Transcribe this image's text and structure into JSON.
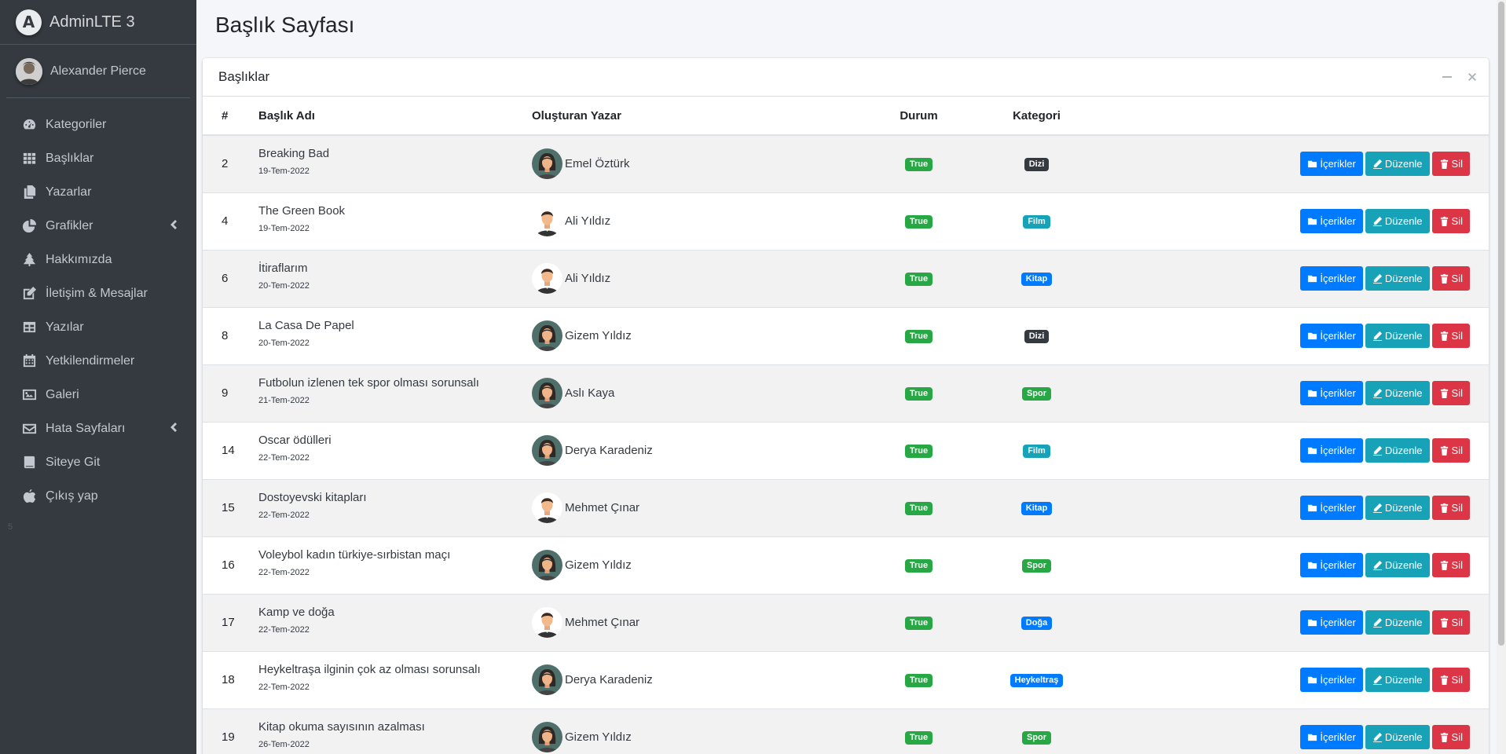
{
  "brand": {
    "name": "AdminLTE 3",
    "logo_letter": "A"
  },
  "user": {
    "name": "Alexander Pierce"
  },
  "sidebar": {
    "items": [
      {
        "label": "Kategoriler",
        "icon": "tachometer-icon",
        "chevron": false
      },
      {
        "label": "Başlıklar",
        "icon": "grid-icon",
        "chevron": false
      },
      {
        "label": "Yazarlar",
        "icon": "copy-icon",
        "chevron": false
      },
      {
        "label": "Grafikler",
        "icon": "pie-chart-icon",
        "chevron": true
      },
      {
        "label": "Hakkımızda",
        "icon": "tree-icon",
        "chevron": false
      },
      {
        "label": "İletişim & Mesajlar",
        "icon": "edit-icon",
        "chevron": false
      },
      {
        "label": "Yazılar",
        "icon": "table-icon",
        "chevron": false
      },
      {
        "label": "Yetkilendirmeler",
        "icon": "calendar-icon",
        "chevron": false
      },
      {
        "label": "Galeri",
        "icon": "image-icon",
        "chevron": false
      },
      {
        "label": "Hata Sayfaları",
        "icon": "envelope-icon",
        "chevron": true
      },
      {
        "label": "Siteye Git",
        "icon": "book-icon",
        "chevron": false
      },
      {
        "label": "Çıkış yap",
        "icon": "apple-icon",
        "chevron": false
      }
    ],
    "footer_small": "5"
  },
  "page": {
    "title": "Başlık Sayfası"
  },
  "card": {
    "title": "Başlıklar"
  },
  "table": {
    "headers": [
      "#",
      "Başlık Adı",
      "Oluşturan Yazar",
      "Durum",
      "Kategori",
      ""
    ],
    "rows": [
      {
        "id": "2",
        "title": "Breaking Bad",
        "date": "19-Tem-2022",
        "author": "Emel Öztürk",
        "avatar": "female",
        "status": "True",
        "category": "Dizi",
        "cat_color": "#343a40"
      },
      {
        "id": "4",
        "title": "The Green Book",
        "date": "19-Tem-2022",
        "author": "Ali Yıldız",
        "avatar": "male",
        "status": "True",
        "category": "Film",
        "cat_color": "#17a2b8"
      },
      {
        "id": "6",
        "title": "İtiraflarım",
        "date": "20-Tem-2022",
        "author": "Ali Yıldız",
        "avatar": "male",
        "status": "True",
        "category": "Kitap",
        "cat_color": "#007bff"
      },
      {
        "id": "8",
        "title": "La Casa De Papel",
        "date": "20-Tem-2022",
        "author": "Gizem Yıldız",
        "avatar": "female",
        "status": "True",
        "category": "Dizi",
        "cat_color": "#343a40"
      },
      {
        "id": "9",
        "title": "Futbolun izlenen tek spor olması sorunsalı",
        "date": "21-Tem-2022",
        "author": "Aslı Kaya",
        "avatar": "female",
        "status": "True",
        "category": "Spor",
        "cat_color": "#28a745"
      },
      {
        "id": "14",
        "title": "Oscar ödülleri",
        "date": "22-Tem-2022",
        "author": "Derya Karadeniz",
        "avatar": "female",
        "status": "True",
        "category": "Film",
        "cat_color": "#17a2b8"
      },
      {
        "id": "15",
        "title": "Dostoyevski kitapları",
        "date": "22-Tem-2022",
        "author": "Mehmet Çınar",
        "avatar": "male",
        "status": "True",
        "category": "Kitap",
        "cat_color": "#007bff"
      },
      {
        "id": "16",
        "title": "Voleybol kadın türkiye-sırbistan maçı",
        "date": "22-Tem-2022",
        "author": "Gizem Yıldız",
        "avatar": "female",
        "status": "True",
        "category": "Spor",
        "cat_color": "#28a745"
      },
      {
        "id": "17",
        "title": "Kamp ve doğa",
        "date": "22-Tem-2022",
        "author": "Mehmet Çınar",
        "avatar": "male",
        "status": "True",
        "category": "Doğa",
        "cat_color": "#007bff"
      },
      {
        "id": "18",
        "title": "Heykeltraşa ilginin çok az olması sorunsalı",
        "date": "22-Tem-2022",
        "author": "Derya Karadeniz",
        "avatar": "female",
        "status": "True",
        "category": "Heykeltraş",
        "cat_color": "#007bff"
      },
      {
        "id": "19",
        "title": "Kitap okuma sayısının azalması",
        "date": "26-Tem-2022",
        "author": "Gizem Yıldız",
        "avatar": "female",
        "status": "True",
        "category": "Spor",
        "cat_color": "#28a745"
      }
    ],
    "status_color": "#28a745",
    "actions": {
      "contents": "İçerikler",
      "edit": "Düzenle",
      "delete": "Sil"
    }
  },
  "colors": {
    "sidebar_bg": "#343a40",
    "primary": "#007bff",
    "info": "#17a2b8",
    "danger": "#dc3545",
    "success": "#28a745"
  }
}
